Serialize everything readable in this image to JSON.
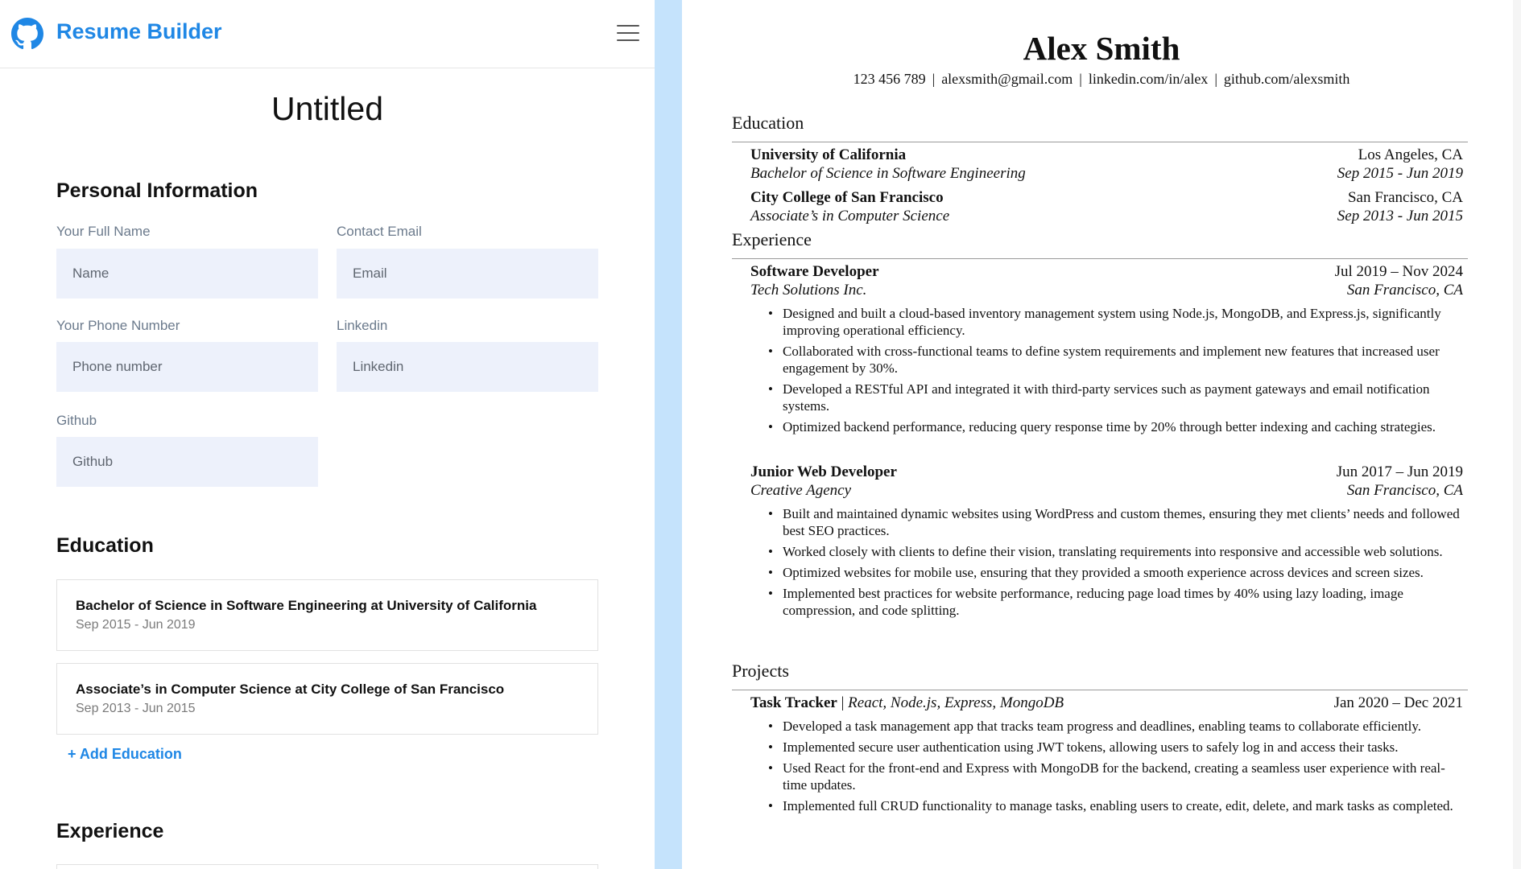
{
  "app": {
    "brand": "Resume Builder",
    "doc_title": "Untitled",
    "logo_icon": "github-icon",
    "menu_icon": "hamburger-menu-icon"
  },
  "colors": {
    "accent": "#1f87e5",
    "input_bg": "#edf1fb",
    "divider": "#c5e3fc"
  },
  "personal": {
    "heading": "Personal Information",
    "fields": {
      "name": {
        "label": "Your Full Name",
        "placeholder": "Name"
      },
      "email": {
        "label": "Contact Email",
        "placeholder": "Email"
      },
      "phone": {
        "label": "Your Phone Number",
        "placeholder": "Phone number"
      },
      "linkedin": {
        "label": "Linkedin",
        "placeholder": "Linkedin"
      },
      "github": {
        "label": "Github",
        "placeholder": "Github"
      }
    }
  },
  "education_editor": {
    "heading": "Education",
    "items": [
      {
        "title": "Bachelor of Science in Software Engineering at University of California",
        "dates": "Sep 2015 - Jun 2019"
      },
      {
        "title": "Associate’s in Computer Science at City College of San Francisco",
        "dates": "Sep 2013 - Jun 2015"
      }
    ],
    "add_label": "+ Add Education"
  },
  "experience_editor": {
    "heading": "Experience"
  },
  "resume": {
    "name": "Alex Smith",
    "contact": [
      "123 456 789",
      "alexsmith@gmail.com",
      "linkedin.com/in/alex",
      "github.com/alexsmith"
    ],
    "separator": "|",
    "education": {
      "heading": "Education",
      "items": [
        {
          "school": "University of California",
          "location": "Los Angeles, CA",
          "degree": "Bachelor of Science in Software Engineering",
          "dates": "Sep 2015 - Jun 2019"
        },
        {
          "school": "City College of San Francisco",
          "location": "San Francisco, CA",
          "degree": "Associate’s in Computer Science",
          "dates": "Sep 2013 - Jun 2015"
        }
      ]
    },
    "experience": {
      "heading": "Experience",
      "items": [
        {
          "title": "Software Developer",
          "dates": "Jul 2019 – Nov 2024",
          "company": "Tech Solutions Inc.",
          "location": "San Francisco, CA",
          "bullets": [
            "Designed and built a cloud-based inventory management system using Node.js, MongoDB, and Express.js, significantly improving operational efficiency.",
            "Collaborated with cross-functional teams to define system requirements and implement new features that increased user engagement by 30%.",
            "Developed a RESTful API and integrated it with third-party services such as payment gateways and email notification systems.",
            "Optimized backend performance, reducing query response time by 20% through better indexing and caching strategies."
          ]
        },
        {
          "title": "Junior Web Developer",
          "dates": "Jun 2017 – Jun 2019",
          "company": "Creative Agency",
          "location": "San Francisco, CA",
          "bullets": [
            "Built and maintained dynamic websites using WordPress and custom themes, ensuring they met clients’ needs and followed best SEO practices.",
            "Worked closely with clients to define their vision, translating requirements into responsive and accessible web solutions.",
            "Optimized websites for mobile use, ensuring that they provided a smooth experience across devices and screen sizes.",
            "Implemented best practices for website performance, reducing page load times by 40% using lazy loading, image compression, and code splitting."
          ]
        }
      ]
    },
    "projects": {
      "heading": "Projects",
      "items": [
        {
          "name": "Task Tracker",
          "tech": "React, Node.js, Express, MongoDB",
          "dates": "Jan 2020 – Dec 2021",
          "bullets": [
            "Developed a task management app that tracks team progress and deadlines, enabling teams to collaborate efficiently.",
            "Implemented secure user authentication using JWT tokens, allowing users to safely log in and access their tasks.",
            "Used React for the front-end and Express with MongoDB for the backend, creating a seamless user experience with real-time updates.",
            "Implemented full CRUD functionality to manage tasks, enabling users to create, edit, delete, and mark tasks as completed."
          ]
        }
      ]
    }
  }
}
